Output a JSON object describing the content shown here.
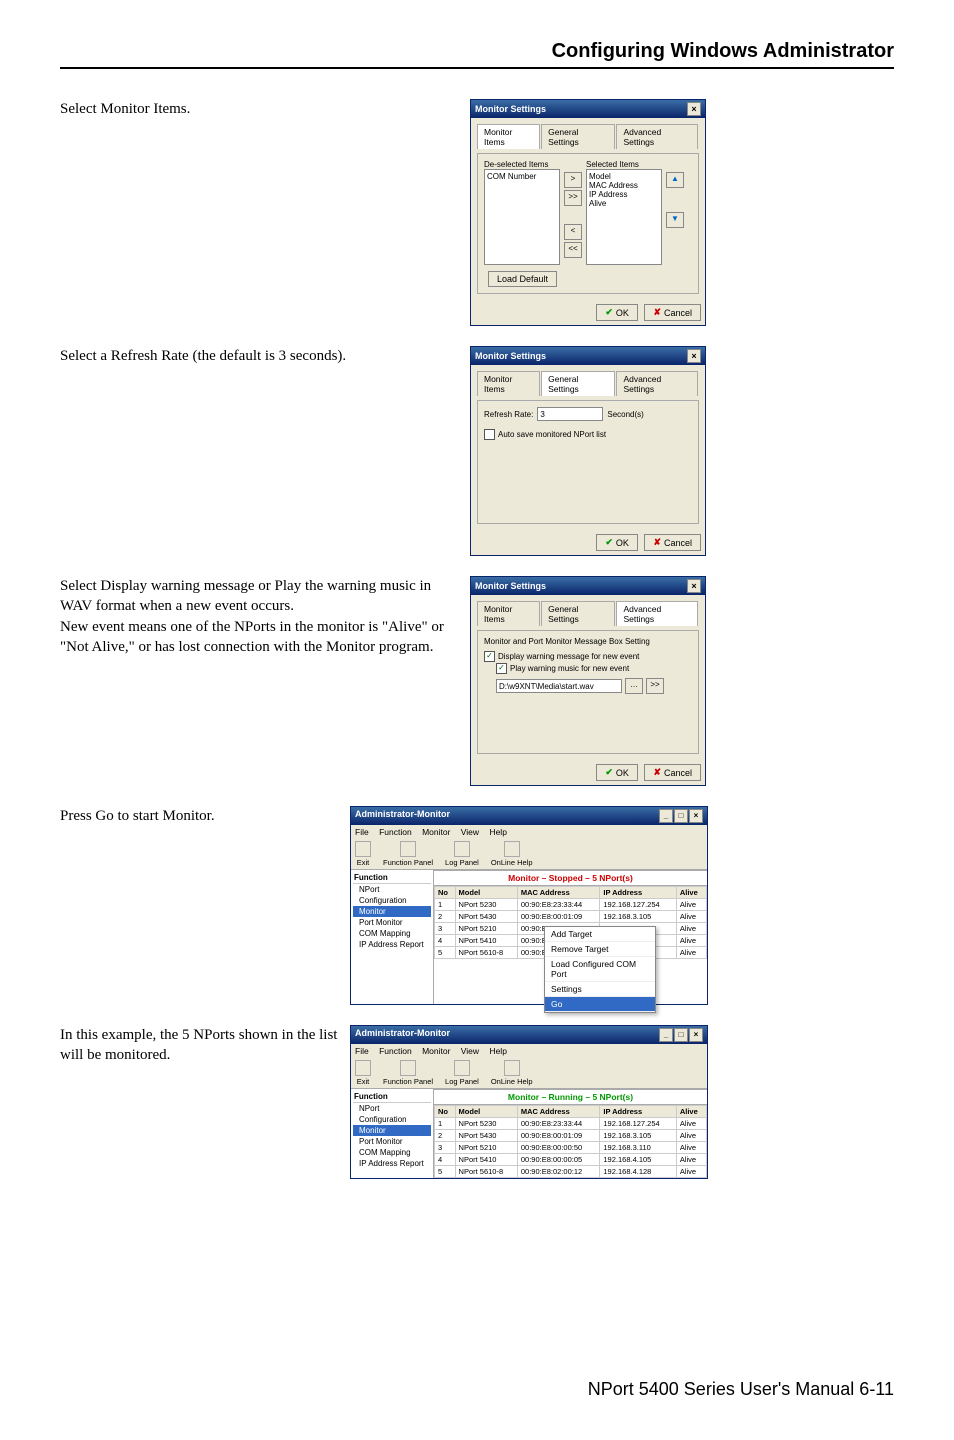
{
  "page_header": "Configuring Windows Administrator",
  "footer": "NPort 5400 Series User's Manual 6-11",
  "steps": {
    "s1": "Select Monitor Items.",
    "s2": "Select a Refresh Rate (the default is 3 seconds).",
    "s3": "Select Display warning message or Play the warning music in WAV format when a new event occurs.\nNew event means one of the NPorts in the monitor is \"Alive\" or \"Not Alive,\" or has lost connection with the Monitor program.",
    "s4": "Press Go to start Monitor.",
    "s5": "In this example, the 5 NPorts shown in the list will be monitored."
  },
  "dialog": {
    "title": "Monitor Settings",
    "close": "×",
    "tabs": {
      "t1": "Monitor Items",
      "t2": "General Settings",
      "t3": "Advanced Settings"
    },
    "ok": "OK",
    "cancel": "Cancel",
    "ok_glyph": "✔",
    "cancel_glyph": "✘",
    "d1": {
      "deselected_label": "De-selected Items",
      "selected_label": "Selected Items",
      "deselected_items": [
        "COM Number"
      ],
      "selected_items": [
        "Model",
        "MAC Address",
        "IP Address",
        "Alive"
      ],
      "load_default": "Load Default"
    },
    "d2": {
      "refresh_label": "Refresh Rate:",
      "refresh_value": "3",
      "seconds_label": "Second(s)",
      "auto_save": "Auto save monitored NPort list"
    },
    "d3": {
      "group_label": "Monitor and Port Monitor Message Box Setting",
      "cb1": "Display warning message for new event",
      "cb2": "Play warning music for new event",
      "path": "D:\\w9XNT\\Media\\start.wav",
      "browse": ">>"
    }
  },
  "admin": {
    "title": "Administrator-Monitor",
    "menus": [
      "File",
      "Function",
      "Monitor",
      "View",
      "Help"
    ],
    "toolbar": [
      {
        "label": "Exit"
      },
      {
        "label": "Function Panel"
      },
      {
        "label": "Log Panel"
      },
      {
        "label": "OnLine Help"
      }
    ],
    "status_stopped": "Monitor – Stopped – 5 NPort(s)",
    "status_running": "Monitor – Running – 5 NPort(s)",
    "sidebar_header": "Function",
    "sidebar": [
      "NPort",
      " Configuration",
      " Monitor",
      " Port Monitor",
      " COM Mapping",
      " IP Address Report"
    ],
    "columns": [
      "No",
      "Model",
      "MAC Address",
      "IP Address",
      "Alive"
    ],
    "rows": [
      {
        "no": "1",
        "model": "NPort 5230",
        "mac": "00:90:E8:23:33:44",
        "ip": "192.168.127.254",
        "alive": "Alive"
      },
      {
        "no": "2",
        "model": "NPort 5430",
        "mac": "00:90:E8:00:01:09",
        "ip": "192.168.3.105",
        "alive": "Alive"
      },
      {
        "no": "3",
        "model": "NPort 5210",
        "mac": "00:90:E8:00:00:50",
        "ip": "192.168.3.110",
        "alive": "Alive"
      },
      {
        "no": "4",
        "model": "NPort 5410",
        "mac": "00:90:E8:00:00:05",
        "ip": "192.168.4.105",
        "alive": "Alive"
      },
      {
        "no": "5",
        "model": "NPort 5610-8",
        "mac": "00:90:E8:02:00:12",
        "ip": "192.168.4.128",
        "alive": "Alive"
      }
    ],
    "ctx": [
      "Add Target",
      "Remove Target",
      "Load Configured COM Port",
      "Settings",
      "Go"
    ]
  }
}
